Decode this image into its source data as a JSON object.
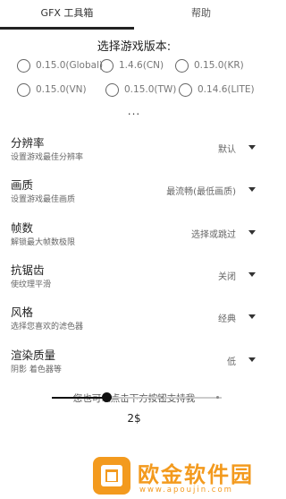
{
  "tabs": [
    {
      "label": "GFX 工具箱",
      "active": true
    },
    {
      "label": "帮助",
      "active": false
    }
  ],
  "version_section": {
    "title": "选择游戏版本:",
    "options": [
      {
        "label": "0.15.0(Global)"
      },
      {
        "label": "1.4.6(CN)"
      },
      {
        "label": "0.15.0(KR)"
      },
      {
        "label": "0.15.0(VN)"
      },
      {
        "label": "0.15.0(TW)"
      },
      {
        "label": "0.14.6(LITE)"
      }
    ],
    "more": "..."
  },
  "settings": [
    {
      "title": "分辨率",
      "desc": "设置游戏最佳分辨率",
      "value": "默认"
    },
    {
      "title": "画质",
      "desc": "设置游戏最佳画质",
      "value": "最流畅(最低画质)"
    },
    {
      "title": "帧数",
      "desc": "解锁最大帧数极限",
      "value": "选择或跳过"
    },
    {
      "title": "抗锯齿",
      "desc": "使纹理平滑",
      "value": "关闭"
    },
    {
      "title": "风格",
      "desc": "选择您喜欢的滤色器",
      "value": "经典"
    },
    {
      "title": "渲染质量",
      "desc": "阴影 着色器等",
      "value": "低"
    }
  ],
  "support": {
    "text": "您也可以点击下方按钮支持我",
    "amount": "2$",
    "slider_position": 0.33
  },
  "watermark": {
    "brand": "欧金软件园",
    "url": "www.apoujin.com",
    "color": "#f39a1e"
  }
}
